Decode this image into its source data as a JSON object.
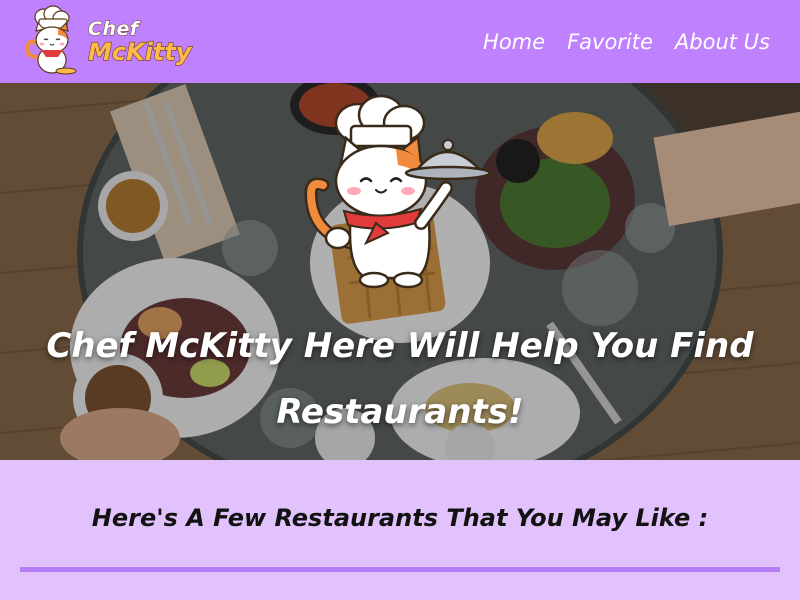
{
  "brand": {
    "name_line1": "Chef",
    "name_line2": "McKitty",
    "logo_icon": "chef-cat-icon",
    "text_color": "#ffffff",
    "accent_color": "#ffb84a"
  },
  "nav": {
    "background": "#c081ff",
    "items": [
      {
        "label": "Home"
      },
      {
        "label": "Favorite"
      },
      {
        "label": "About Us"
      }
    ]
  },
  "hero": {
    "title": "Chef McKitty Here Will Help You Find Restaurants!",
    "mascot_icon": "chef-cat-cloche-icon",
    "background_image": "restaurant-table-photo"
  },
  "section": {
    "heading": "Here's A Few Restaurants That You May Like :",
    "background": "#e2c2fc",
    "divider_color": "#b57cf5"
  }
}
